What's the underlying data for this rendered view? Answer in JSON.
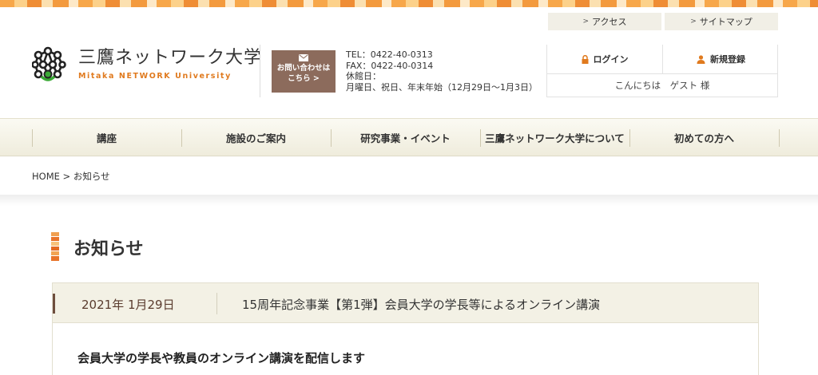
{
  "header": {
    "util_links": [
      {
        "label": "アクセス",
        "arrow": ">"
      },
      {
        "label": "サイトマップ",
        "arrow": ">"
      }
    ],
    "logo": {
      "jp": "三鷹ネットワーク大学",
      "en": "Mitaka NETWORK University"
    },
    "contact": {
      "button_line1": "お問い合わせは",
      "button_line2": "こちら >",
      "tel": "TEL：0422-40-0313",
      "fax": "FAX：0422-40-0314",
      "closed_label": "休館日：",
      "closed_days": "月曜日、祝日、年末年始（12月29日〜1月3日）"
    },
    "account": {
      "login": "ログイン",
      "register": "新規登録",
      "greeting": "こんにちは　ゲスト 様"
    }
  },
  "nav": {
    "items": [
      {
        "label": "講座"
      },
      {
        "label": "施設のご案内"
      },
      {
        "label": "研究事業・イベント"
      },
      {
        "label": "三鷹ネットワーク大学について"
      },
      {
        "label": "初めての方へ"
      }
    ]
  },
  "breadcrumb": {
    "home": "HOME",
    "sep": ">",
    "current": "お知らせ"
  },
  "page": {
    "title": "お知らせ"
  },
  "news": {
    "date": "2021年 1月29日",
    "title": "15周年記念事業【第1弾】会員大学の学長等によるオンライン講演",
    "body_heading": "会員大学の学長や教員のオンライン講演を配信します"
  },
  "colors": {
    "accent": "#e07a1e",
    "brown": "#8c6b5c",
    "dark_brown": "#6e4e3e"
  }
}
